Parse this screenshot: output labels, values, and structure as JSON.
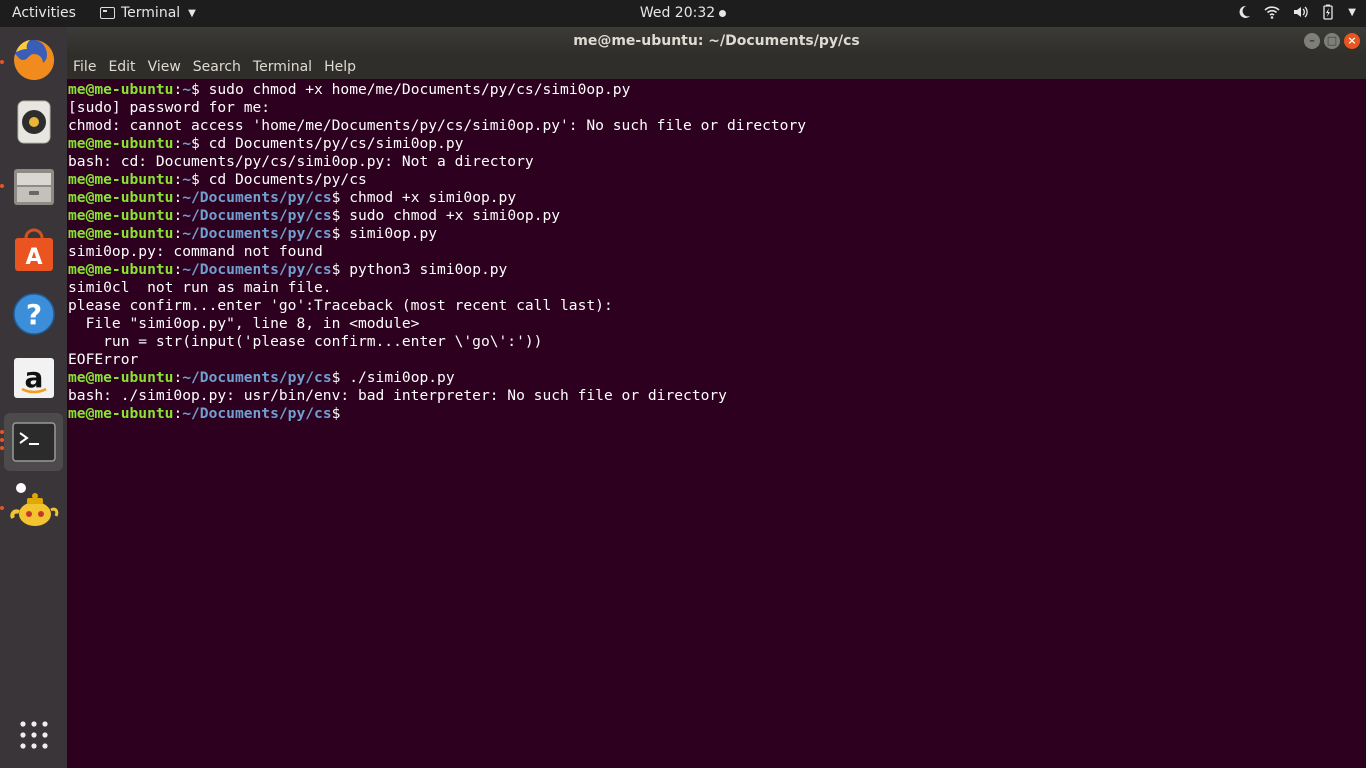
{
  "topbar": {
    "activities": "Activities",
    "app_menu": "Terminal",
    "clock": "Wed 20:32"
  },
  "dock": {
    "items": [
      {
        "name": "firefox-icon",
        "running": true
      },
      {
        "name": "rhythmbox-icon",
        "running": false
      },
      {
        "name": "files-icon",
        "running": true
      },
      {
        "name": "software-center-icon",
        "running": false
      },
      {
        "name": "help-icon",
        "running": false
      },
      {
        "name": "amazon-icon",
        "running": false
      },
      {
        "name": "terminal-icon",
        "running": true
      },
      {
        "name": "teapot-icon",
        "running": true
      }
    ]
  },
  "window": {
    "title": "me@me-ubuntu: ~/Documents/py/cs",
    "menu": [
      "File",
      "Edit",
      "View",
      "Search",
      "Terminal",
      "Help"
    ]
  },
  "terminal": {
    "lines": [
      {
        "user": "me@me-ubuntu",
        "path": "~",
        "cmd": " sudo chmod +x home/me/Documents/py/cs/simi0op.py"
      },
      {
        "out": "[sudo] password for me:"
      },
      {
        "out": "chmod: cannot access 'home/me/Documents/py/cs/simi0op.py': No such file or directory"
      },
      {
        "user": "me@me-ubuntu",
        "path": "~",
        "cmd": " cd Documents/py/cs/simi0op.py"
      },
      {
        "out": "bash: cd: Documents/py/cs/simi0op.py: Not a directory"
      },
      {
        "user": "me@me-ubuntu",
        "path": "~",
        "cmd": " cd Documents/py/cs"
      },
      {
        "user": "me@me-ubuntu",
        "path": "~/Documents/py/cs",
        "cmd": " chmod +x simi0op.py"
      },
      {
        "user": "me@me-ubuntu",
        "path": "~/Documents/py/cs",
        "cmd": " sudo chmod +x simi0op.py"
      },
      {
        "user": "me@me-ubuntu",
        "path": "~/Documents/py/cs",
        "cmd": " simi0op.py"
      },
      {
        "out": "simi0op.py: command not found"
      },
      {
        "user": "me@me-ubuntu",
        "path": "~/Documents/py/cs",
        "cmd": " python3 simi0op.py"
      },
      {
        "out": "simi0cl  not run as main file."
      },
      {
        "out": "please confirm...enter 'go':Traceback (most recent call last):"
      },
      {
        "out": "  File \"simi0op.py\", line 8, in <module>"
      },
      {
        "out": "    run = str(input('please confirm...enter \\'go\\':'))"
      },
      {
        "out": "EOFError"
      },
      {
        "user": "me@me-ubuntu",
        "path": "~/Documents/py/cs",
        "cmd": " ./simi0op.py"
      },
      {
        "out": "bash: ./simi0op.py: usr/bin/env: bad interpreter: No such file or directory"
      },
      {
        "user": "me@me-ubuntu",
        "path": "~/Documents/py/cs",
        "cmd": ""
      }
    ]
  }
}
